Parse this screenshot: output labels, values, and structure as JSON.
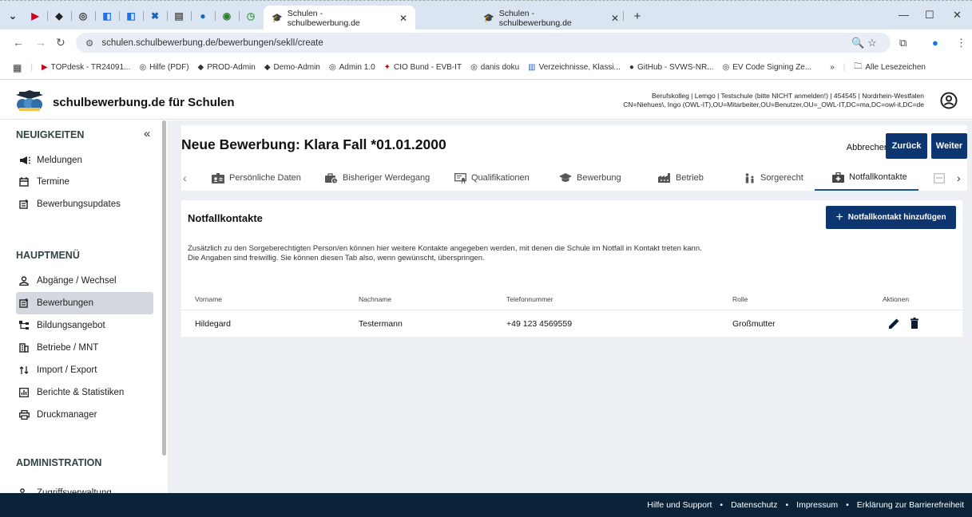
{
  "browser": {
    "tabs": [
      {
        "title": "Schulen - schulbewerbung.de",
        "active": true
      },
      {
        "title": "Schulen - schulbewerbung.de",
        "active": false
      }
    ],
    "new_tab": "+",
    "url": "schulen.schulbewerbung.de/bewerbungen/seklI/create",
    "bookmarks": [
      "TOPdesk - TR24091...",
      "Hilfe (PDF)",
      "PROD-Admin",
      "Demo-Admin",
      "Admin 1.0",
      "CIO Bund - EVB-IT",
      "danis doku",
      "Verzeichnisse, Klassi...",
      "GitHub - SVWS-NR...",
      "EV Code Signing Ze..."
    ],
    "more_bookmarks": "»",
    "all_bookmarks": "Alle Lesezeichen"
  },
  "app": {
    "title": "schulbewerbung.de für Schulen",
    "context_line1": "Berufskolleg | Lemgo | Testschule (bitte NICHT anmelden!) | 454545 | Nordrhein-Westfalen",
    "context_line2": "CN=Niehues\\, Ingo (OWL-IT),OU=Mitarbeiter,OU=Benutzer,OU=_OWL-IT,DC=ma,DC=owl-it,DC=de"
  },
  "sidebar": {
    "sections": [
      {
        "title": "NEUIGKEITEN",
        "items": [
          {
            "label": "Meldungen"
          },
          {
            "label": "Termine"
          },
          {
            "label": "Bewerbungsupdates"
          }
        ]
      },
      {
        "title": "HAUPTMENÜ",
        "items": [
          {
            "label": "Abgänge / Wechsel"
          },
          {
            "label": "Bewerbungen"
          },
          {
            "label": "Bildungsangebot"
          },
          {
            "label": "Betriebe / MNT"
          },
          {
            "label": "Import / Export"
          },
          {
            "label": "Berichte & Statistiken"
          },
          {
            "label": "Druckmanager"
          }
        ]
      },
      {
        "title": "ADMINISTRATION",
        "items": [
          {
            "label": "Zugriffsverwaltung"
          }
        ]
      }
    ],
    "collapse_label": "«"
  },
  "page": {
    "title": "Neue Bewerbung: Klara Fall *01.01.2000",
    "cancel_label": "Abbrechen",
    "back_label": "Zurück",
    "next_label": "Weiter",
    "tabs": [
      {
        "label": "Persönliche Daten"
      },
      {
        "label": "Bisheriger Werdegang"
      },
      {
        "label": "Qualifikationen"
      },
      {
        "label": "Bewerbung"
      },
      {
        "label": "Betrieb"
      },
      {
        "label": "Sorgerecht"
      },
      {
        "label": "Notfallkontakte",
        "active": true
      }
    ]
  },
  "card": {
    "title": "Notfallkontakte",
    "add_label": "Notfallkontakt hinzufügen",
    "info_line1": "Zusätzlich zu den Sorgeberechtigten Person/en können hier weitere Kontakte angegeben werden, mit denen die Schule im Notfall in Kontakt treten kann.",
    "info_line2": "Die Angaben sind freiwillig. Sie können diesen Tab also, wenn gewünscht, überspringen.",
    "columns": [
      "Vorname",
      "Nachname",
      "Telefonnummer",
      "Rolle",
      "Aktionen"
    ],
    "rows": [
      {
        "vorname": "Hildegard",
        "nachname": "Testermann",
        "telefon": "+49 123 4569559",
        "rolle": "Großmutter"
      }
    ]
  },
  "footer": {
    "links": [
      "Hilfe und Support",
      "Datenschutz",
      "Impressum",
      "Erklärung zur Barrierefreiheit"
    ],
    "separator": "•"
  },
  "colors": {
    "primary": "#0d3570",
    "footer": "#0a2338",
    "tab_underline": "#1c4f9c"
  },
  "icons": {
    "edit": "pencil-icon",
    "delete": "trash-icon",
    "add": "plus-icon"
  }
}
